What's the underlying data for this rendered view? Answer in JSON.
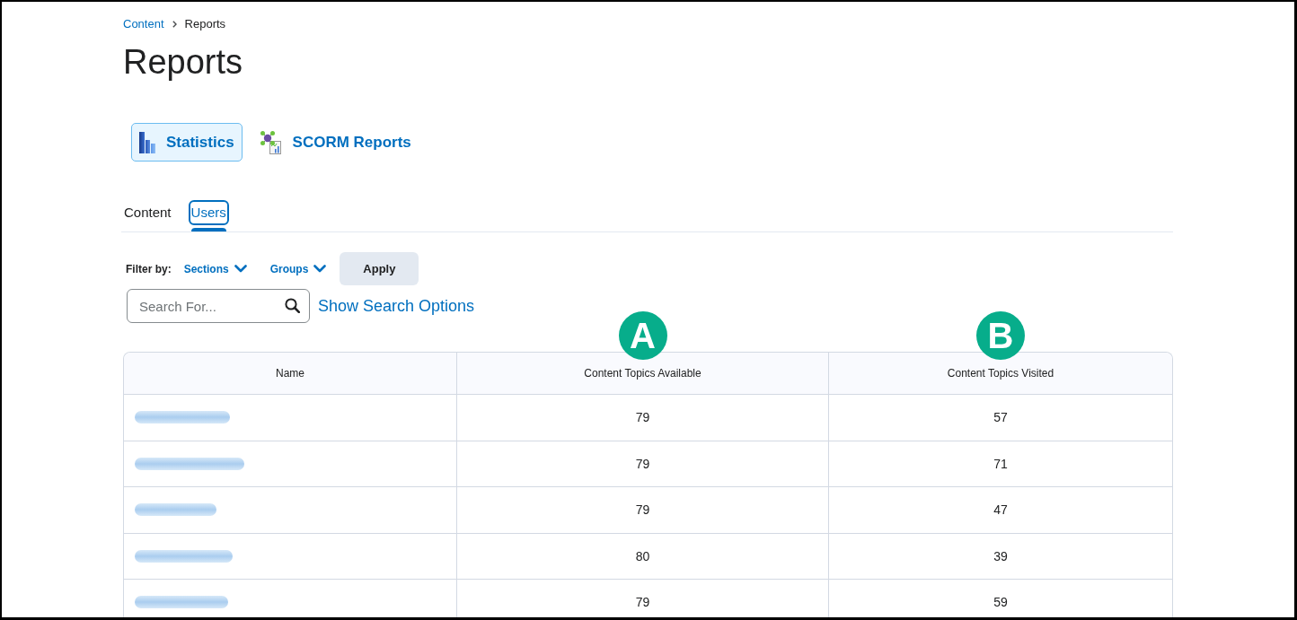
{
  "breadcrumb": {
    "links": [
      "Content"
    ],
    "current": "Reports"
  },
  "title": "Reports",
  "report_types": [
    {
      "kind": "statistics",
      "label": "Statistics",
      "selected": true
    },
    {
      "kind": "scorm",
      "label": "SCORM Reports",
      "selected": false
    }
  ],
  "tabs": [
    {
      "label": "Content",
      "selected": false,
      "focused": false
    },
    {
      "label": "Users",
      "selected": true,
      "focused": true
    }
  ],
  "filter": {
    "label": "Filter by:",
    "dropdowns": [
      "Sections",
      "Groups"
    ],
    "apply_button": "Apply"
  },
  "search": {
    "placeholder": "Search For...",
    "options_link": "Show Search Options"
  },
  "table": {
    "columns": [
      {
        "label": "Name"
      },
      {
        "label": "Content Topics Available",
        "callout": "A"
      },
      {
        "label": "Content Topics Visited",
        "callout": "B"
      }
    ],
    "rows": [
      {
        "name_redacted": true,
        "cells": [
          "",
          "79",
          "57"
        ]
      },
      {
        "name_redacted": true,
        "cells": [
          "",
          "79",
          "71"
        ]
      },
      {
        "name_redacted": true,
        "cells": [
          "",
          "79",
          "47"
        ]
      },
      {
        "name_redacted": true,
        "cells": [
          "",
          "80",
          "39"
        ]
      },
      {
        "name_redacted": true,
        "cells": [
          "",
          "79",
          "59"
        ]
      }
    ]
  }
}
